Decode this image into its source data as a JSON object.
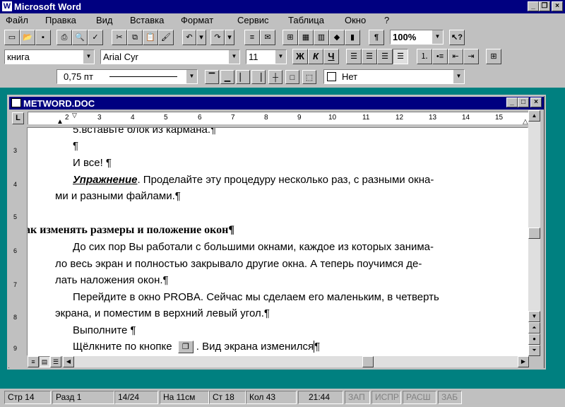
{
  "app_title": "Microsoft Word",
  "menu": [
    "Файл",
    "Правка",
    "Вид",
    "Вставка",
    "Формат",
    "Сервис",
    "Таблица",
    "Окно",
    "?"
  ],
  "toolbar": {
    "zoom": "100%",
    "style": "книга",
    "font": "Arial Cyr",
    "size": "11",
    "bold": "Ж",
    "italic": "К",
    "underline": "Ч",
    "paragraph_mark": "¶",
    "border_width": "0,75 пт",
    "shading": "Нет"
  },
  "document": {
    "title": "METWORD.DOC",
    "ruler_numbers": [
      "2",
      "3",
      "4",
      "5",
      "6",
      "7",
      "8",
      "9",
      "10",
      "11",
      "12",
      "13",
      "14",
      "15"
    ],
    "vruler_numbers": [
      "3",
      "4",
      "5",
      "6",
      "7",
      "8",
      "9"
    ],
    "lines": [
      "5.вставьте блок из кармана.¶",
      "¶",
      " И все! ¶",
      "Упражнение",
      ". Проделайте эту процедуру несколько раз, с разными окна-",
      "ми и разными файлами.¶",
      "ак изменять размеры и положение окон¶",
      " До сих пор Вы работали с большими окнами, каждое  из которых занима-",
      "ло весь экран и полностью закрывало другие окна. А теперь поучимся де-",
      "лать наложения окон.¶",
      "Перейдите в окно PROBA. Сейчас мы сделаем его маленьким, в четверть",
      "экрана, и поместим в верхний левый угол.¶",
      "Выполните ¶",
      "Щёлкните по кнопке",
      ". Вид экрана изменился",
      "¶"
    ]
  },
  "status": {
    "page": "Стр 14",
    "section": "Разд 1",
    "pages": "14/24",
    "at": "На 11см",
    "line": "Ст 18",
    "col": "Кол 43",
    "time": "21:44",
    "rec": "ЗАП",
    "trk": "ИСПР",
    "ext": "РАСШ",
    "ovr": "ЗАБ"
  }
}
